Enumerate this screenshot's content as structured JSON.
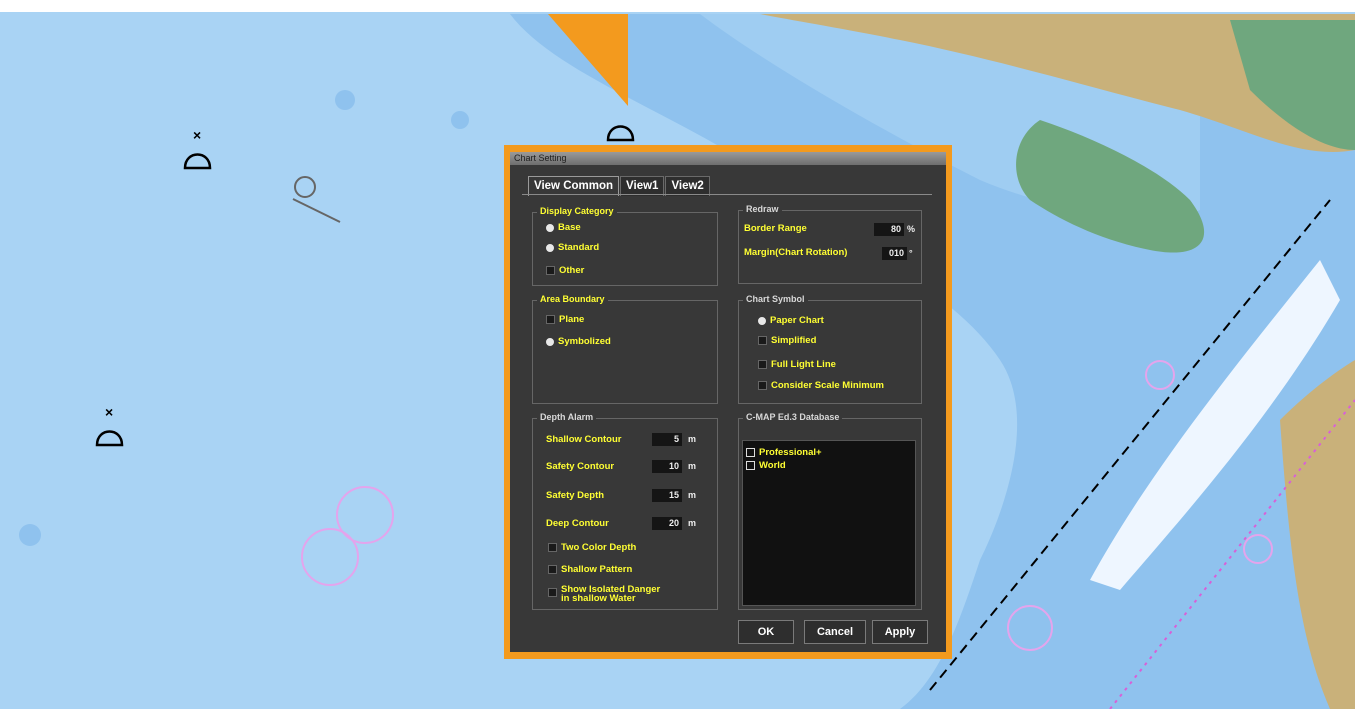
{
  "dialog": {
    "title": "Chart Setting",
    "tabs": [
      "View Common",
      "View1",
      "View2"
    ],
    "display_category": {
      "title": "Display Category",
      "options": [
        {
          "label": "Base",
          "checked": true
        },
        {
          "label": "Standard",
          "checked": true
        },
        {
          "label": "Other",
          "checked": false
        }
      ]
    },
    "redraw": {
      "title": "Redraw",
      "border_range_label": "Border Range",
      "border_range_value": "80",
      "border_range_unit": "%",
      "margin_label": "Margin(Chart Rotation)",
      "margin_value": "010",
      "margin_unit": "°"
    },
    "area_boundary": {
      "title": "Area Boundary",
      "options": [
        {
          "label": "Plane",
          "selected": false
        },
        {
          "label": "Symbolized",
          "selected": true
        }
      ]
    },
    "chart_symbol": {
      "title": "Chart Symbol",
      "options": [
        {
          "label": "Paper Chart",
          "selected": true
        },
        {
          "label": "Simplified",
          "selected": false
        }
      ],
      "checks": [
        {
          "label": "Full Light Line",
          "checked": false
        },
        {
          "label": "Consider Scale Minimum",
          "checked": false
        }
      ]
    },
    "depth_alarm": {
      "title": "Depth Alarm",
      "fields": [
        {
          "label": "Shallow Contour",
          "value": "5",
          "unit": "m"
        },
        {
          "label": "Safety Contour",
          "value": "10",
          "unit": "m"
        },
        {
          "label": "Safety Depth",
          "value": "15",
          "unit": "m"
        },
        {
          "label": "Deep Contour",
          "value": "20",
          "unit": "m"
        }
      ],
      "checks": [
        {
          "label": "Two Color Depth",
          "checked": false
        },
        {
          "label": "Shallow Pattern",
          "checked": false
        },
        {
          "label": "Show Isolated Danger",
          "label2": "in shallow Water",
          "checked": false
        }
      ]
    },
    "cmap": {
      "title": "C-MAP Ed.3 Database",
      "items": [
        {
          "label": "Professional+",
          "checked": false
        },
        {
          "label": "World",
          "checked": false
        }
      ]
    },
    "buttons": {
      "ok": "OK",
      "cancel": "Cancel",
      "apply": "Apply"
    }
  },
  "colors": {
    "highlight_frame": "#f39a1e",
    "dialog_bg": "#383838",
    "label_yellow": "#ffff33",
    "sea_shallow": "#a9d3f4",
    "sea_mid": "#8fc2ee",
    "land": "#c9b17a",
    "land_green": "#6fa77e"
  }
}
